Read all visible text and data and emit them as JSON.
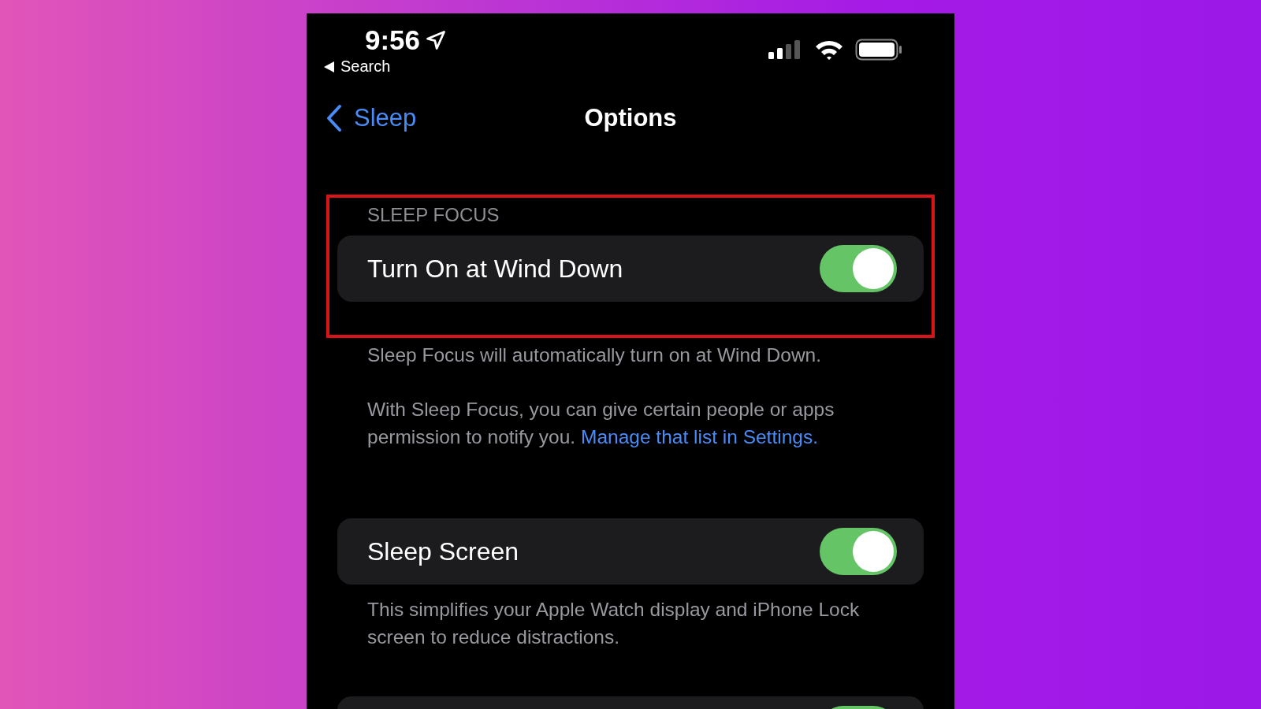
{
  "status_bar": {
    "time": "9:56",
    "back_label": "Search"
  },
  "nav": {
    "back": "Sleep",
    "title": "Options"
  },
  "sections": [
    {
      "header": "SLEEP FOCUS",
      "highlighted": true,
      "rows": [
        {
          "label": "Turn On at Wind Down",
          "on": true
        }
      ],
      "footer": [
        {
          "text": "Sleep Focus will automatically turn on at Wind Down."
        },
        {
          "text": "With Sleep Focus, you can give certain people or apps permission to notify you.",
          "link": "Manage that list in Settings."
        }
      ]
    },
    {
      "rows": [
        {
          "label": "Sleep Screen",
          "on": true
        }
      ],
      "footer": [
        {
          "text": "This simplifies your Apple Watch display and iPhone Lock screen to reduce distractions."
        }
      ]
    },
    {
      "rows": [
        {
          "on": true
        }
      ]
    }
  ]
}
